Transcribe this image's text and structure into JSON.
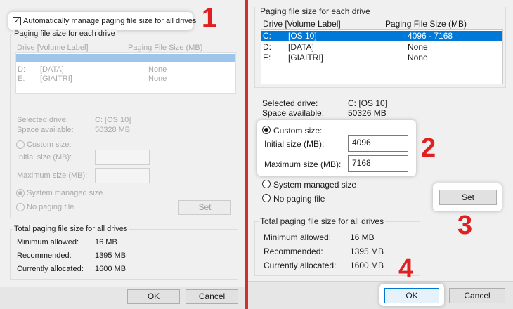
{
  "left": {
    "auto_manage_label": "Automatically manage paging file size for all drives",
    "group_title": "Paging file size for each drive",
    "col_drive": "Drive  [Volume Label]",
    "col_size": "Paging File Size (MB)",
    "rows": [
      {
        "drive": "D:",
        "label": "[DATA]",
        "size": "None"
      },
      {
        "drive": "E:",
        "label": "[GIAITRI]",
        "size": "None"
      }
    ],
    "selected_drive_label": "Selected drive:",
    "selected_drive_value": "C:  [OS 10]",
    "space_label": "Space available:",
    "space_value": "50328 MB",
    "custom_size": "Custom size:",
    "initial_size": "Initial size (MB):",
    "maximum_size": "Maximum size (MB):",
    "system_managed": "System managed size",
    "no_paging": "No paging file",
    "set_label": "Set",
    "total_title": "Total paging file size for all drives",
    "min_label": "Minimum allowed:",
    "min_value": "16 MB",
    "rec_label": "Recommended:",
    "rec_value": "1395 MB",
    "cur_label": "Currently allocated:",
    "cur_value": "1600 MB",
    "ok_label": "OK",
    "cancel_label": "Cancel"
  },
  "right": {
    "group_title": "Paging file size for each drive",
    "col_drive": "Drive  [Volume Label]",
    "col_size": "Paging File Size (MB)",
    "rows": [
      {
        "drive": "C:",
        "label": "[OS 10]",
        "size": "4096 - 7168"
      },
      {
        "drive": "D:",
        "label": "[DATA]",
        "size": "None"
      },
      {
        "drive": "E:",
        "label": "[GIAITRI]",
        "size": "None"
      }
    ],
    "selected_drive_label": "Selected drive:",
    "selected_drive_value": "C:  [OS 10]",
    "space_label": "Space available:",
    "space_value": "50326 MB",
    "custom_size": "Custom size:",
    "initial_size": "Initial size (MB):",
    "initial_value": "4096",
    "maximum_size": "Maximum size (MB):",
    "maximum_value": "7168",
    "system_managed": "System managed size",
    "no_paging": "No paging file",
    "set_label": "Set",
    "total_title": "Total paging file size for all drives",
    "min_label": "Minimum allowed:",
    "min_value": "16 MB",
    "rec_label": "Recommended:",
    "rec_value": "1395 MB",
    "cur_label": "Currently allocated:",
    "cur_value": "1600 MB",
    "ok_label": "OK",
    "cancel_label": "Cancel"
  },
  "steps": [
    "1",
    "2",
    "3",
    "4"
  ],
  "colors": {
    "accent": "#0078d7",
    "step": "#e02020",
    "frame": "#d0312d"
  }
}
